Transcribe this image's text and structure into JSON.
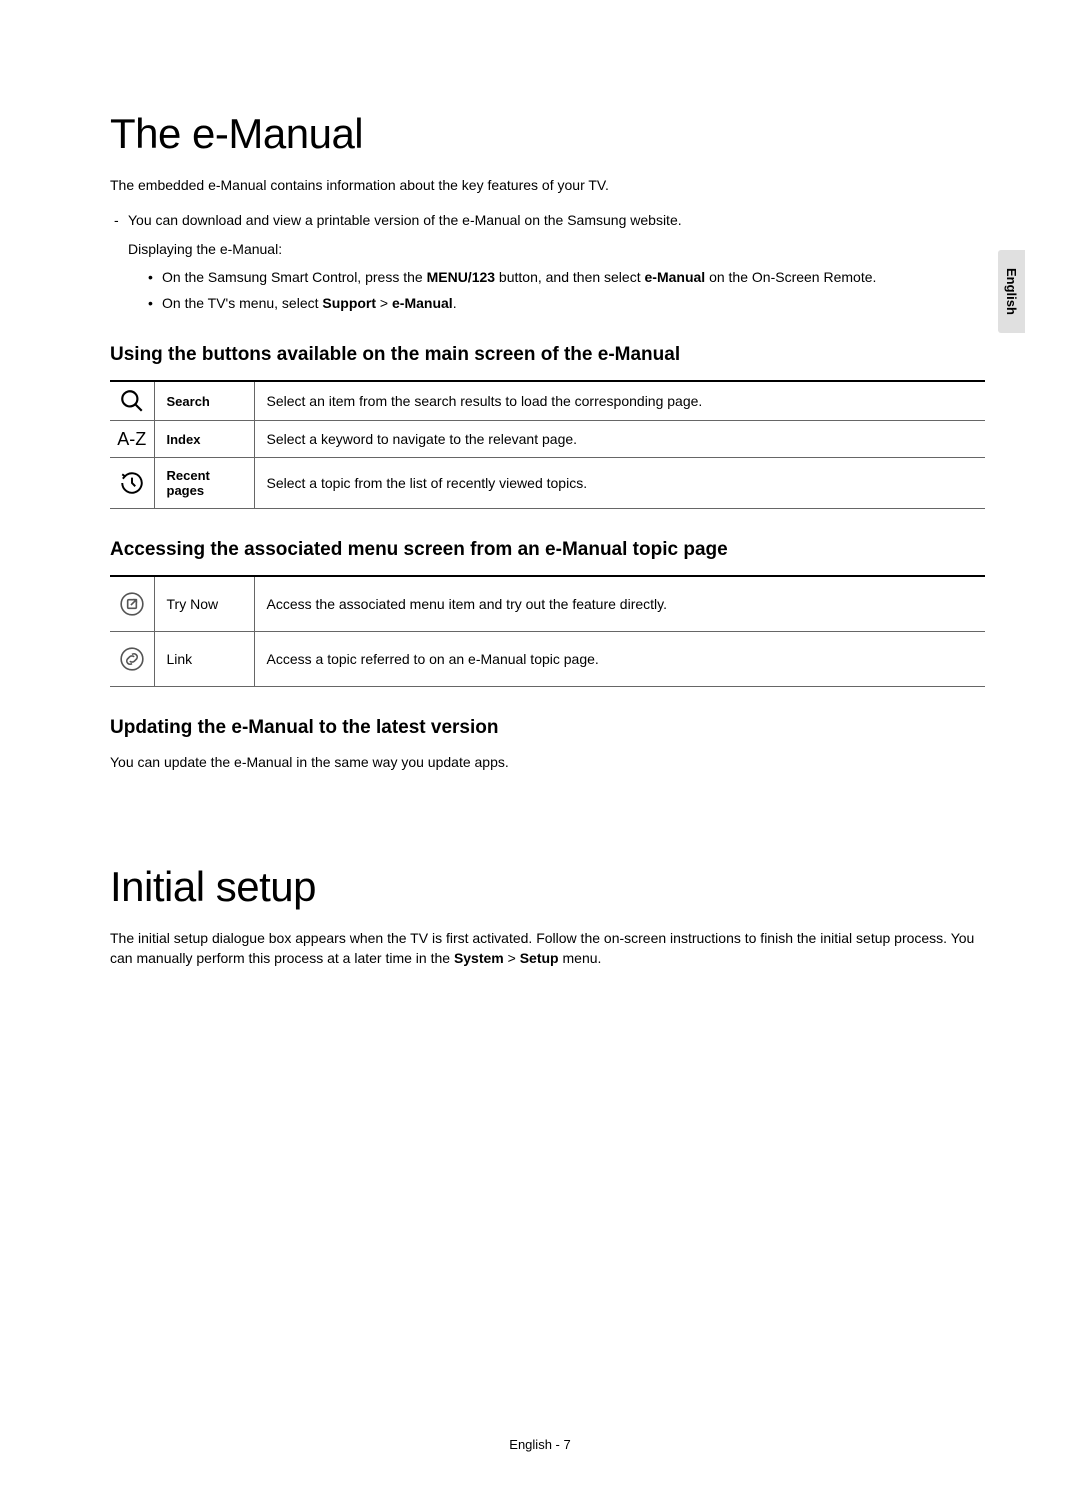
{
  "sideTab": "English",
  "section1": {
    "heading": "The e-Manual",
    "intro": "The embedded e-Manual contains information about the key features of your TV.",
    "dash1": "You can download and view a printable version of the e-Manual on the Samsung website.",
    "subline": "Displaying the e-Manual:",
    "bullet1_pre": "On the Samsung Smart Control, press the ",
    "bullet1_bold1": "MENU/123",
    "bullet1_mid": " button, and then select ",
    "bullet1_bold2": "e-Manual",
    "bullet1_post": " on the On-Screen Remote.",
    "bullet2_pre": "On the TV's menu, select ",
    "bullet2_bold1": "Support",
    "bullet2_mid": " > ",
    "bullet2_bold2": "e-Manual",
    "bullet2_post": ".",
    "sub1": {
      "heading": "Using the buttons available on the main screen of the e-Manual",
      "rows": [
        {
          "label": "Search",
          "desc": "Select an item from the search results to load the corresponding page."
        },
        {
          "label": "Index",
          "desc": "Select a keyword to navigate to the relevant page."
        },
        {
          "label": "Recent pages",
          "desc": "Select a topic from the list of recently viewed topics."
        }
      ]
    },
    "sub2": {
      "heading": "Accessing the associated menu screen from an e-Manual topic page",
      "rows": [
        {
          "label": "Try Now",
          "desc": "Access the associated menu item and try out the feature directly."
        },
        {
          "label": "Link",
          "desc": "Access a topic referred to on an e-Manual topic page."
        }
      ]
    },
    "sub3": {
      "heading": "Updating the e-Manual to the latest version",
      "text": "You can update the e-Manual in the same way you update apps."
    }
  },
  "section2": {
    "heading": "Initial setup",
    "text_pre": "The initial setup dialogue box appears when the TV is first activated. Follow the on-screen instructions to finish the initial setup process. You can manually perform this process at a later time in the ",
    "bold1": "System",
    "mid": " > ",
    "bold2": "Setup",
    "post": " menu."
  },
  "footer": "English - 7",
  "icons": {
    "az": "A-Z"
  }
}
